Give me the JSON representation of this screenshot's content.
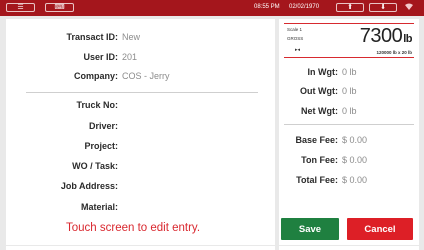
{
  "topbar": {
    "menu_icon": "☰",
    "keyboard_icon": "⌨",
    "time": "08:55 PM",
    "date": "02/02/1970",
    "up_icon": "⬆",
    "down_icon": "⬇",
    "wifi_icon": "wifi-icon"
  },
  "transaction": {
    "transact_id_label": "Transact ID:",
    "transact_id_value": "New",
    "user_id_label": "User ID:",
    "user_id_value": "201",
    "company_label": "Company:",
    "company_value": "COS - Jerry"
  },
  "details": {
    "truck_label": "Truck No:",
    "driver_label": "Driver:",
    "project_label": "Project:",
    "wo_label": "WO / Task:",
    "job_label": "Job Address:",
    "material_label": "Material:"
  },
  "touch_message": "Touch screen to edit entry.",
  "scale": {
    "name": "Scale 1",
    "mode": "GROSS",
    "indicator": "▸◂",
    "weight": "7300",
    "unit": "lb",
    "capacity": "120000 lb x 20 lb"
  },
  "weights": {
    "in_label": "In Wgt:",
    "in_value": "0 lb",
    "out_label": "Out Wgt:",
    "out_value": "0 lb",
    "net_label": "Net Wgt:",
    "net_value": "0 lb"
  },
  "fees": {
    "base_label": "Base Fee:",
    "base_value": "$ 0.00",
    "ton_label": "Ton Fee:",
    "ton_value": "$ 0.00",
    "total_label": "Total Fee:",
    "total_value": "$ 0.00"
  },
  "buttons": {
    "save": "Save",
    "cancel": "Cancel"
  },
  "colors": {
    "topbar": "#a4161c",
    "save": "#1f8040",
    "cancel": "#dd1f26",
    "message": "#d9282f"
  }
}
